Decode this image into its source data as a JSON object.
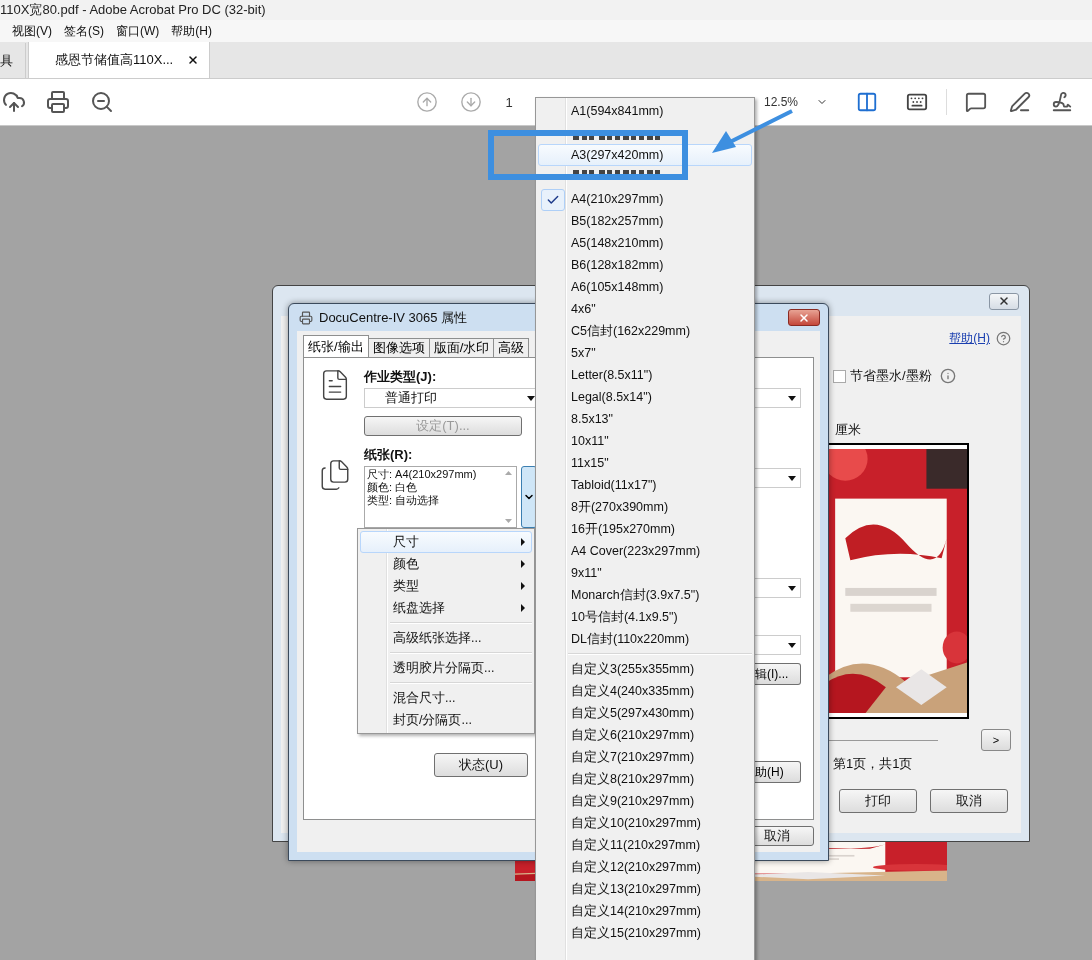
{
  "app_window": {
    "title": "110X宽80.pdf - Adobe Acrobat Pro DC (32-bit)"
  },
  "menu_bar": [
    "视图(V)",
    "签名(S)",
    "窗口(W)",
    "帮助(H)"
  ],
  "tabs": [
    {
      "label": "具",
      "selected": false
    },
    {
      "label": "感恩节储值高110X...",
      "selected": true
    }
  ],
  "toolbar": {
    "page": "1",
    "zoom": "12.5%"
  },
  "print_dialog": {
    "help_link": "帮助(H)",
    "save_ink": {
      "label": "节省墨水/墨粉",
      "checked": false
    },
    "unit": "厘米",
    "next_button": ">",
    "page_info": "第1页，共1页",
    "buttons": [
      "打印",
      "取消"
    ]
  },
  "properties_dialog": {
    "title": "DocuCentre-IV 3065 属性",
    "tabs": [
      {
        "label": "纸张/输出",
        "selected": true
      },
      {
        "label": "图像选项",
        "selected": false
      },
      {
        "label": "版面/水印",
        "selected": false
      },
      {
        "label": "高级",
        "selected": false
      }
    ],
    "job_type_label": "作业类型(J):",
    "job_type": "普通打印",
    "settings_button": {
      "label": "设定(T)...",
      "disabled": true
    },
    "paper_label": "纸张(R):",
    "paper_info": [
      "尺寸: A4(210x297mm)",
      "颜色: 白色",
      "类型: 自动选择"
    ],
    "paper_button_pressed": true,
    "side_buttons": [
      "辑(I)...",
      "助(H)"
    ],
    "status_button": "状态(U)",
    "cancel_button": "取消"
  },
  "paper_menu": {
    "groups": [
      [
        {
          "label": "尺寸",
          "selected": true,
          "submenu": true
        },
        {
          "label": "颜色",
          "selected": false,
          "submenu": true
        },
        {
          "label": "类型",
          "selected": false,
          "submenu": true
        },
        {
          "label": "纸盘选择",
          "selected": false,
          "submenu": true
        }
      ],
      [
        {
          "label": "高级纸张选择...",
          "selected": false,
          "submenu": false
        }
      ],
      [
        {
          "label": "透明胶片分隔页...",
          "selected": false,
          "submenu": false
        }
      ],
      [
        {
          "label": "混合尺寸...",
          "selected": false,
          "submenu": false
        },
        {
          "label": "封页/分隔页...",
          "selected": false,
          "submenu": false
        }
      ]
    ]
  },
  "size_menu": {
    "groups": [
      [
        {
          "label": "A1(594x841mm)",
          "selected": false,
          "checked": false
        },
        {
          "kind": "covered"
        },
        {
          "label": "A3(297x420mm)",
          "selected": true,
          "checked": false
        },
        {
          "kind": "covered"
        },
        {
          "label": "A4(210x297mm)",
          "selected": false,
          "checked": true
        },
        {
          "label": "B5(182x257mm)",
          "selected": false,
          "checked": false
        },
        {
          "label": "A5(148x210mm)",
          "selected": false,
          "checked": false
        },
        {
          "label": "B6(128x182mm)",
          "selected": false,
          "checked": false
        },
        {
          "label": "A6(105x148mm)",
          "selected": false,
          "checked": false
        },
        {
          "label": "4x6\"",
          "selected": false,
          "checked": false
        },
        {
          "label": "C5信封(162x229mm)",
          "selected": false,
          "checked": false
        },
        {
          "label": "5x7\"",
          "selected": false,
          "checked": false
        },
        {
          "label": "Letter(8.5x11\")",
          "selected": false,
          "checked": false
        },
        {
          "label": "Legal(8.5x14\")",
          "selected": false,
          "checked": false
        },
        {
          "label": "8.5x13\"",
          "selected": false,
          "checked": false
        },
        {
          "label": "10x11\"",
          "selected": false,
          "checked": false
        },
        {
          "label": "11x15\"",
          "selected": false,
          "checked": false
        },
        {
          "label": "Tabloid(11x17\")",
          "selected": false,
          "checked": false
        },
        {
          "label": "8开(270x390mm)",
          "selected": false,
          "checked": false
        },
        {
          "label": "16开(195x270mm)",
          "selected": false,
          "checked": false
        },
        {
          "label": "A4 Cover(223x297mm)",
          "selected": false,
          "checked": false
        },
        {
          "label": "9x11\"",
          "selected": false,
          "checked": false
        },
        {
          "label": "Monarch信封(3.9x7.5\")",
          "selected": false,
          "checked": false
        },
        {
          "label": "10号信封(4.1x9.5\")",
          "selected": false,
          "checked": false
        },
        {
          "label": "DL信封(110x220mm)",
          "selected": false,
          "checked": false
        }
      ],
      [
        {
          "label": "自定义3(255x355mm)",
          "selected": false,
          "checked": false
        },
        {
          "label": "自定义4(240x335mm)",
          "selected": false,
          "checked": false
        },
        {
          "label": "自定义5(297x430mm)",
          "selected": false,
          "checked": false
        },
        {
          "label": "自定义6(210x297mm)",
          "selected": false,
          "checked": false
        },
        {
          "label": "自定义7(210x297mm)",
          "selected": false,
          "checked": false
        },
        {
          "label": "自定义8(210x297mm)",
          "selected": false,
          "checked": false
        },
        {
          "label": "自定义9(210x297mm)",
          "selected": false,
          "checked": false
        },
        {
          "label": "自定义10(210x297mm)",
          "selected": false,
          "checked": false
        },
        {
          "label": "自定义11(210x297mm)",
          "selected": false,
          "checked": false
        },
        {
          "label": "自定义12(210x297mm)",
          "selected": false,
          "checked": false
        },
        {
          "label": "自定义13(210x297mm)",
          "selected": false,
          "checked": false
        },
        {
          "label": "自定义14(210x297mm)",
          "selected": false,
          "checked": false
        },
        {
          "label": "自定义15(210x297mm)",
          "selected": false,
          "checked": false
        }
      ]
    ]
  }
}
